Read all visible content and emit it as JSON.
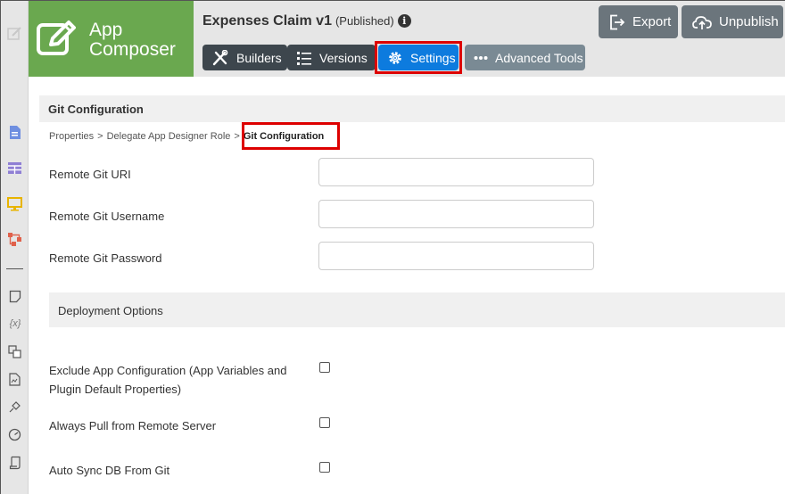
{
  "header": {
    "brand": {
      "line1": "App",
      "line2": "Composer",
      "icon": "edit-square-icon"
    },
    "app_name": "Expenses Claim v1",
    "app_status": "(Published)",
    "info_icon": "i",
    "nav": [
      {
        "label": "Builders",
        "icon": "tools-icon"
      },
      {
        "label": "Versions",
        "icon": "list-icon"
      },
      {
        "label": "Settings",
        "icon": "gear-icon"
      },
      {
        "label": "Advanced Tools",
        "icon": "ellipsis-icon"
      }
    ],
    "actions": {
      "export": "Export",
      "unpublish": "Unpublish"
    }
  },
  "section": {
    "title": "Git Configuration"
  },
  "breadcrumb": {
    "items": [
      "Properties",
      "Delegate App Designer Role"
    ],
    "current": "Git Configuration",
    "separator": ">"
  },
  "form": {
    "remote_uri_label": "Remote Git URI",
    "remote_uri_value": "",
    "username_label": "Remote Git Username",
    "username_value": "",
    "password_label": "Remote Git Password",
    "password_value": ""
  },
  "deployment": {
    "title": "Deployment Options",
    "exclude_line1": "Exclude App Configuration (App Variables and",
    "exclude_line2": "Plugin Default Properties)",
    "always_pull": "Always Pull from Remote Server",
    "auto_sync": "Auto Sync DB From Git"
  },
  "colors": {
    "brand": "#6aa84f",
    "active_tab": "#0d7bde",
    "highlight": "#dd0000"
  }
}
